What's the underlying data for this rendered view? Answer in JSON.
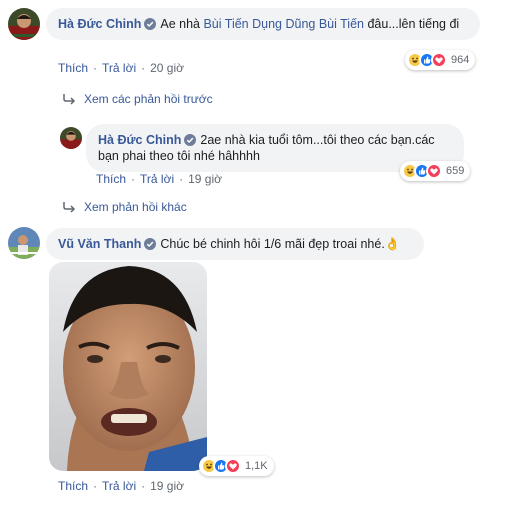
{
  "comments": [
    {
      "author": "Hà Đức Chinh",
      "text_before": "Ae nhà ",
      "mention": "Bùi Tiến Dụng Dũng Bùi Tiến",
      "text_after": " đâu...lên tiếng đi",
      "actions": {
        "like": "Thích",
        "reply": "Trả lời",
        "time": "20 giờ"
      },
      "reactions": {
        "types": [
          "haha-icon",
          "like-icon",
          "love-icon"
        ],
        "count": "964"
      }
    },
    {
      "author": "Hà Đức Chinh",
      "text": "2ae nhà kia tuổi tôm...tôi theo các bạn.các bạn phai theo tôi nhé hâhhhh",
      "actions": {
        "like": "Thích",
        "reply": "Trả lời",
        "time": "19 giờ"
      },
      "reactions": {
        "types": [
          "haha-icon",
          "like-icon",
          "love-icon"
        ],
        "count": "659"
      }
    },
    {
      "author": "Vũ Văn Thanh",
      "text": "Chúc bé chinh hôi 1/6 mãi đẹp troai nhé.",
      "emoji": "👌",
      "actions": {
        "like": "Thích",
        "reply": "Trả lời",
        "time": "19 giờ"
      },
      "reactions": {
        "types": [
          "haha-icon",
          "like-icon",
          "love-icon"
        ],
        "count": "1,1K"
      }
    }
  ],
  "reply_toggles": {
    "previous": "Xem các phản hồi trước",
    "more": "Xem phản hồi khác"
  },
  "colors": {
    "link": "#385898",
    "bubble": "#f2f3f5",
    "meta": "#606770",
    "like_blue": "#1877f2",
    "love_red": "#f33e58",
    "haha_yellow": "#f7c948"
  }
}
